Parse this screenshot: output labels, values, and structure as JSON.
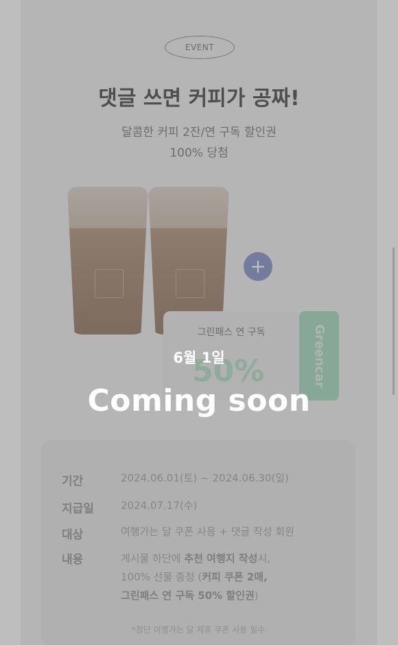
{
  "event": {
    "badge": "EVENT",
    "title": "댓글 쓰면 커피가 공짜!",
    "subtitle_line1": "달콤한 커피 2잔/연 구독 할인권",
    "subtitle_line2": "100% 당첨"
  },
  "coupon": {
    "plus_symbol": "+",
    "label": "그린패스 연 구독",
    "value": "50%",
    "stub_text": "Greencar",
    "accent_color": "#9bd5b8"
  },
  "details": {
    "rows": [
      {
        "label": "기간",
        "value": "2024.06.01(토) ~ 2024.06.30(일)"
      },
      {
        "label": "지급일",
        "value": "2024.07.17(수)"
      },
      {
        "label": "대상",
        "value": "여행가는 달 쿠폰 사용 + 댓글 작성 회원"
      },
      {
        "label": "내용",
        "line1_pre": "게시물 하단에 ",
        "line1_bold": "추천 여행지 작성",
        "line1_post": "시,",
        "line2_pre": "100% 선물 증정 (",
        "line2_bold": "커피 쿠폰 2매,",
        "line2_post": "",
        "line3_bold": "그린패스 연 구독 50% 할인권",
        "line3_post": ")"
      }
    ],
    "footnote": "*참단 여행가는 달 제휴 쿠폰 사용 필수"
  },
  "overlay": {
    "date": "6월 1일",
    "message": "Coming soon"
  },
  "colors": {
    "overlay": "rgba(110,110,110,0.45)",
    "plus_button": "#7787c2"
  }
}
